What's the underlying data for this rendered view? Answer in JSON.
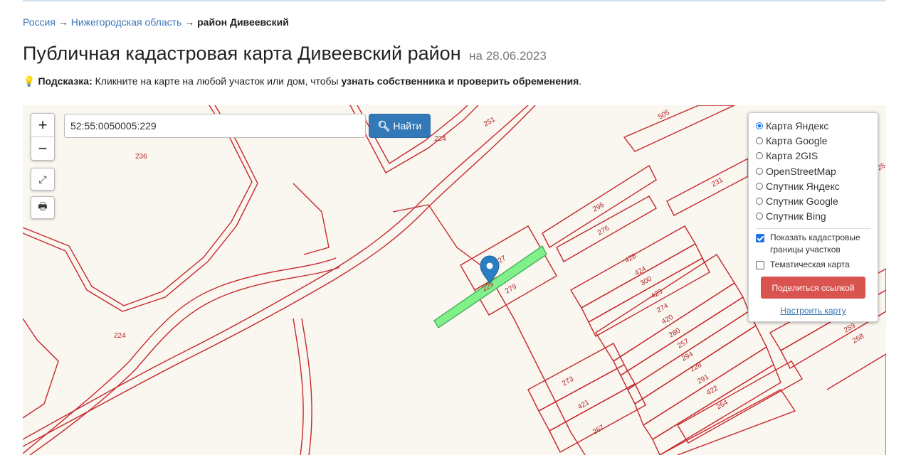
{
  "breadcrumb": {
    "items": [
      "Россия",
      "Нижегородская область"
    ],
    "separator": "→",
    "current": "район Дивеевский"
  },
  "title": {
    "main": "Публичная кадастровая карта Дивеевский район",
    "date": "на 28.06.2023"
  },
  "hint": {
    "label": "Подсказка:",
    "text_before": "Кликните на карте на любой участок или дом, чтобы",
    "emphasis": "узнать собственника и проверить обременения",
    "text_after": "."
  },
  "map": {
    "search": {
      "value": "52:55:0050005:229"
    },
    "find_button": "Найти",
    "zoom_in": "+",
    "zoom_out": "−",
    "parcel_labels": [
      "236",
      "224",
      "224",
      "251",
      "505",
      "231",
      "296",
      "276",
      "227",
      "229",
      "279",
      "428",
      "424",
      "300",
      "423",
      "274",
      "420",
      "280",
      "257",
      "294",
      "228",
      "291",
      "422",
      "264",
      "273",
      "421",
      "267",
      "259",
      "268",
      "25"
    ],
    "colors": {
      "boundary": "#c6282c",
      "selected_parcel": "#7ff08a",
      "marker": "#2a7ec4",
      "background": "#faf6f0"
    }
  },
  "layers": {
    "options": [
      "Карта Яндекс",
      "Карта Google",
      "Карта 2GIS",
      "OpenStreetMap",
      "Спутник Яндекс",
      "Спутник Google",
      "Спутник Bing"
    ],
    "selected": "Карта Яндекс",
    "show_boundaries": {
      "label": "Показать кадастровые границы участков",
      "checked": true
    },
    "thematic": {
      "label": "Тематическая карта",
      "checked": false
    },
    "share_button": "Поделиться ссылкой",
    "configure_link": "Настроить карту"
  }
}
